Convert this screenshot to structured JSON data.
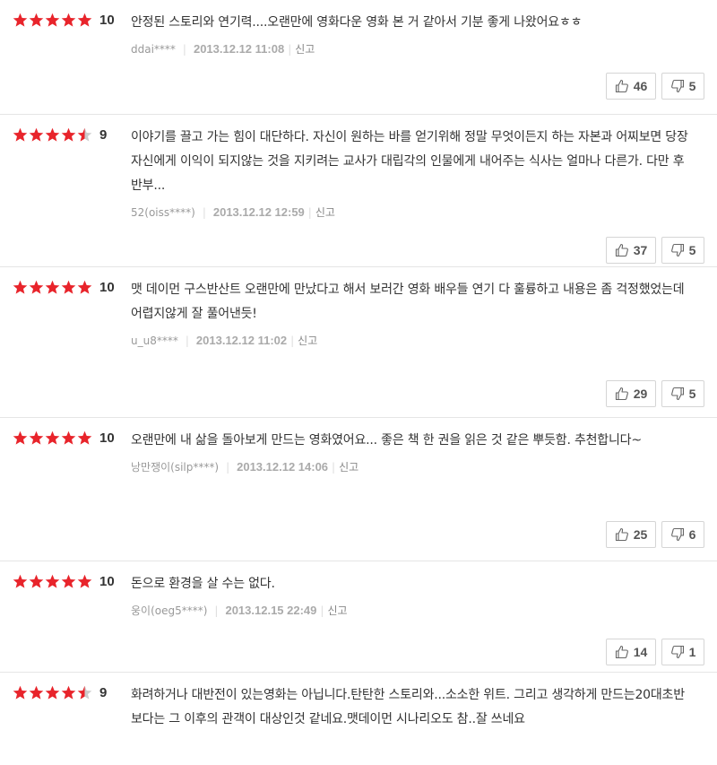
{
  "colors": {
    "star_on": "#e8242b",
    "star_off": "#cccccc"
  },
  "icons": {
    "like": "thumbs-up-icon",
    "dislike": "thumbs-down-icon",
    "star": "star-icon"
  },
  "reviews": [
    {
      "stars": 5,
      "score": "10",
      "text": "안정된 스토리와 연기력....오랜만에 영화다운 영화 본 거 같아서 기분 좋게 나왔어요ㅎㅎ",
      "user": "ddai****",
      "date": "2013.12.12 11:08",
      "report": "신고",
      "likes": "46",
      "dislikes": "5"
    },
    {
      "stars": 4.5,
      "score": "9",
      "text": "이야기를 끌고 가는 힘이 대단하다. 자신이 원하는 바를 얻기위해 정말 무엇이든지 하는 자본과 어찌보면 당장 자신에게 이익이 되지않는 것을 지키려는 교사가 대립각의 인물에게 내어주는 식사는 얼마나 다른가. 다만 후반부...",
      "user": "52(oiss****)",
      "date": "2013.12.12 12:59",
      "report": "신고",
      "likes": "37",
      "dislikes": "5"
    },
    {
      "stars": 5,
      "score": "10",
      "text": "맷 데이먼 구스반산트 오랜만에 만났다고 해서 보러간 영화 배우들 연기 다 훌륭하고 내용은 좀 걱정했었는데 어렵지않게 잘 풀어낸듯!",
      "user": "u_u8****",
      "date": "2013.12.12 11:02",
      "report": "신고",
      "likes": "29",
      "dislikes": "5"
    },
    {
      "stars": 5,
      "score": "10",
      "text": "오랜만에 내 삶을 돌아보게 만드는 영화였어요... 좋은 책 한 권을 읽은 것 같은 뿌듯함. 추천합니다~",
      "user": "낭만쟁이(silp****)",
      "date": "2013.12.12 14:06",
      "report": "신고",
      "likes": "25",
      "dislikes": "6"
    },
    {
      "stars": 5,
      "score": "10",
      "text": "돈으로 환경을 살 수는 없다.",
      "user": "웅이(oeg5****)",
      "date": "2013.12.15 22:49",
      "report": "신고",
      "likes": "14",
      "dislikes": "1"
    },
    {
      "stars": 4.5,
      "score": "9",
      "text": "화려하거나 대반전이 있는영화는 아닙니다.탄탄한 스토리와...소소한 위트. 그리고 생각하게 만드는20대초반보다는 그 이후의 관객이 대상인것 같네요.맷데이먼 시나리오도 참..잘 쓰네요",
      "user": "",
      "date": "",
      "report": "",
      "likes": "",
      "dislikes": ""
    }
  ]
}
